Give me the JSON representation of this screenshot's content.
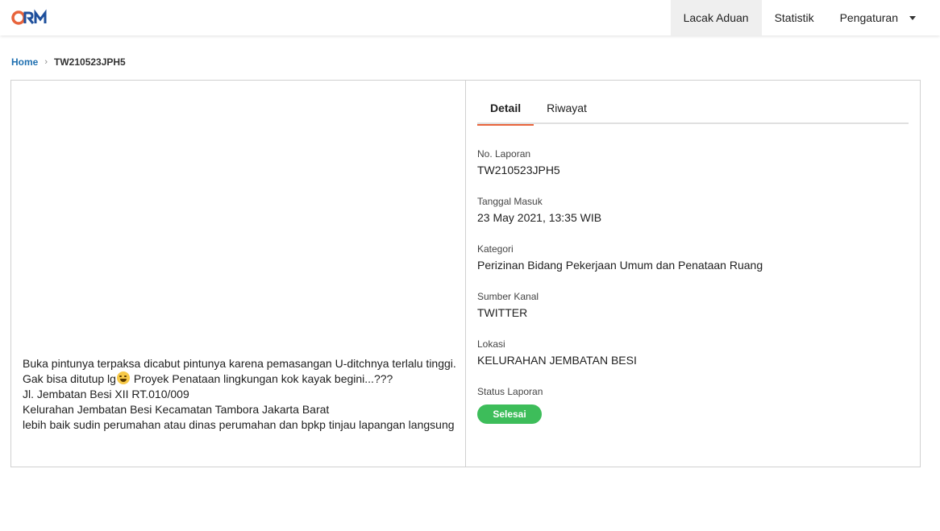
{
  "header": {
    "logo_text": "CRM",
    "nav": [
      {
        "label": "Lacak Aduan",
        "active": true
      },
      {
        "label": "Statistik"
      },
      {
        "label": "Pengaturan",
        "dropdown": true
      }
    ]
  },
  "breadcrumb": {
    "home": "Home",
    "current": "TW210523JPH5"
  },
  "complaint": {
    "lines": [
      "Buka pintunya terpaksa dicabut pintunya karena pemasangan U-ditchnya terlalu tinggi.",
      "Gak bisa ditutup lg",
      "Proyek Penataan lingkungan kok kayak begini...???",
      "Jl. Jembatan Besi XII RT.010/009",
      "Kelurahan Jembatan Besi Kecamatan Tambora Jakarta Barat",
      "lebih baik sudin perumahan atau dinas perumahan dan bpkp tinjau lapangan langsung"
    ]
  },
  "tabs": [
    "Detail",
    "Riwayat"
  ],
  "details": [
    {
      "label": "No. Laporan",
      "value": "TW210523JPH5"
    },
    {
      "label": "Tanggal Masuk",
      "value": "23 May 2021, 13:35 WIB"
    },
    {
      "label": "Kategori",
      "value": "Perizinan Bidang Pekerjaan Umum dan Penataan Ruang"
    },
    {
      "label": "Sumber Kanal",
      "value": "TWITTER"
    },
    {
      "label": "Lokasi",
      "value": "KELURAHAN JEMBATAN BESI"
    }
  ],
  "status": {
    "label": "Status Laporan",
    "value": "Selesai"
  },
  "colors": {
    "accent": "#e8643c",
    "link": "#1e6fb0",
    "status_done": "#3dbd5a",
    "logo_orange": "#e8643c",
    "logo_blue": "#1e4f9c"
  }
}
